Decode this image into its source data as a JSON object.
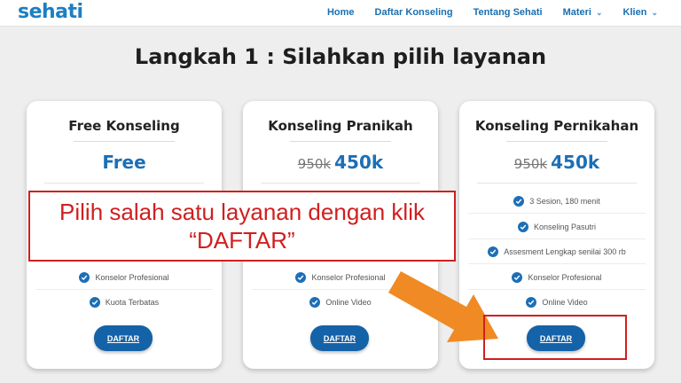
{
  "nav": {
    "logo": "sehati",
    "items": [
      {
        "label": "Home",
        "has_dropdown": false
      },
      {
        "label": "Daftar Konseling",
        "has_dropdown": false
      },
      {
        "label": "Tentang Sehati",
        "has_dropdown": false
      },
      {
        "label": "Materi",
        "has_dropdown": true
      },
      {
        "label": "Klien",
        "has_dropdown": true
      }
    ],
    "dropdown_glyph": "⌄"
  },
  "page": {
    "title": "Langkah 1 : Silahkan pilih layanan"
  },
  "cards": [
    {
      "title": "Free Konseling",
      "old_price": "",
      "price": "Free",
      "features": [
        "Konselor Profesional",
        "Kuota Terbatas"
      ],
      "button_label": "DAFTAR"
    },
    {
      "title": "Konseling Pranikah",
      "old_price": "950k",
      "price": "450k",
      "features": [
        "Konselor Profesional",
        "Online Video"
      ],
      "button_label": "DAFTAR"
    },
    {
      "title": "Konseling Pernikahan",
      "old_price": "950k",
      "price": "450k",
      "features": [
        "3 Sesion, 180 menit",
        "Konseling Pasutri",
        "Assesment Lengkap senilai 300 rb",
        "Konselor Profesional",
        "Online Video"
      ],
      "button_label": "DAFTAR"
    }
  ],
  "annotation": {
    "line1": "Pilih salah satu layanan dengan klik",
    "line2": "“DAFTAR”",
    "color": "#d01f1f",
    "arrow_color": "#f08a24"
  },
  "colors": {
    "brand": "#1c7fc4",
    "button": "#1462a8",
    "price": "#1c6fb6"
  }
}
